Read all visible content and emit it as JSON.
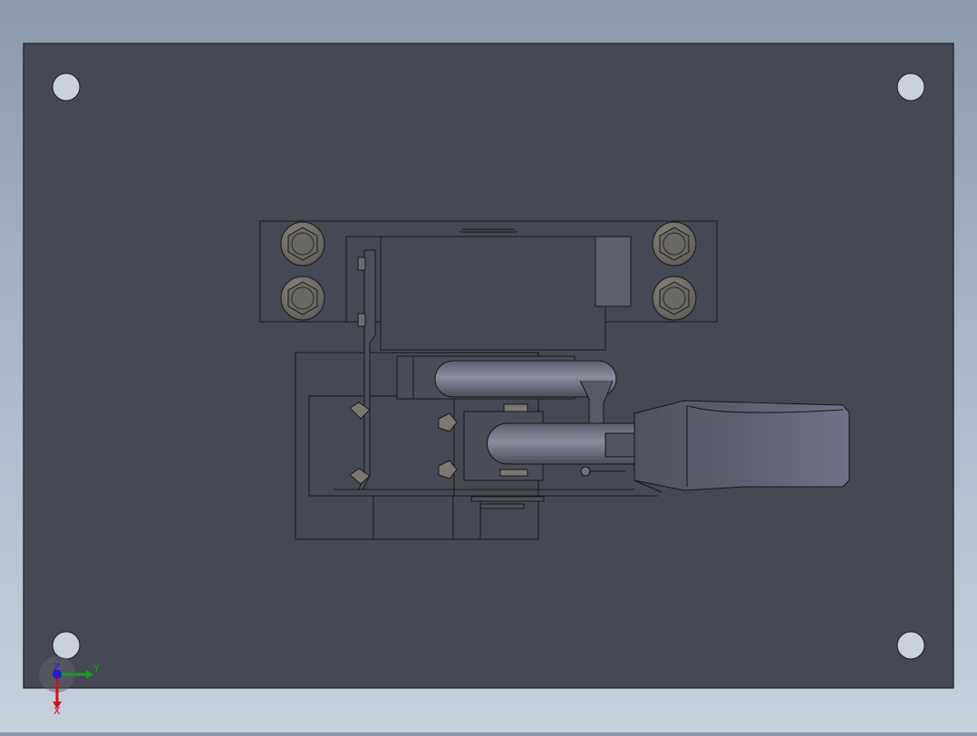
{
  "viewport": {
    "background_top": "#8a99ad",
    "background_bottom": "#c7d0dc",
    "plate_color": "#464953",
    "edge_color": "#1a1b20",
    "hole_color": "#c9d1dc"
  },
  "triad": {
    "x_label": "X",
    "y_label": "Y",
    "z_label": "Z",
    "x_color": "#c8141e",
    "y_color": "#1e9a1e",
    "z_color": "#2020c8"
  }
}
